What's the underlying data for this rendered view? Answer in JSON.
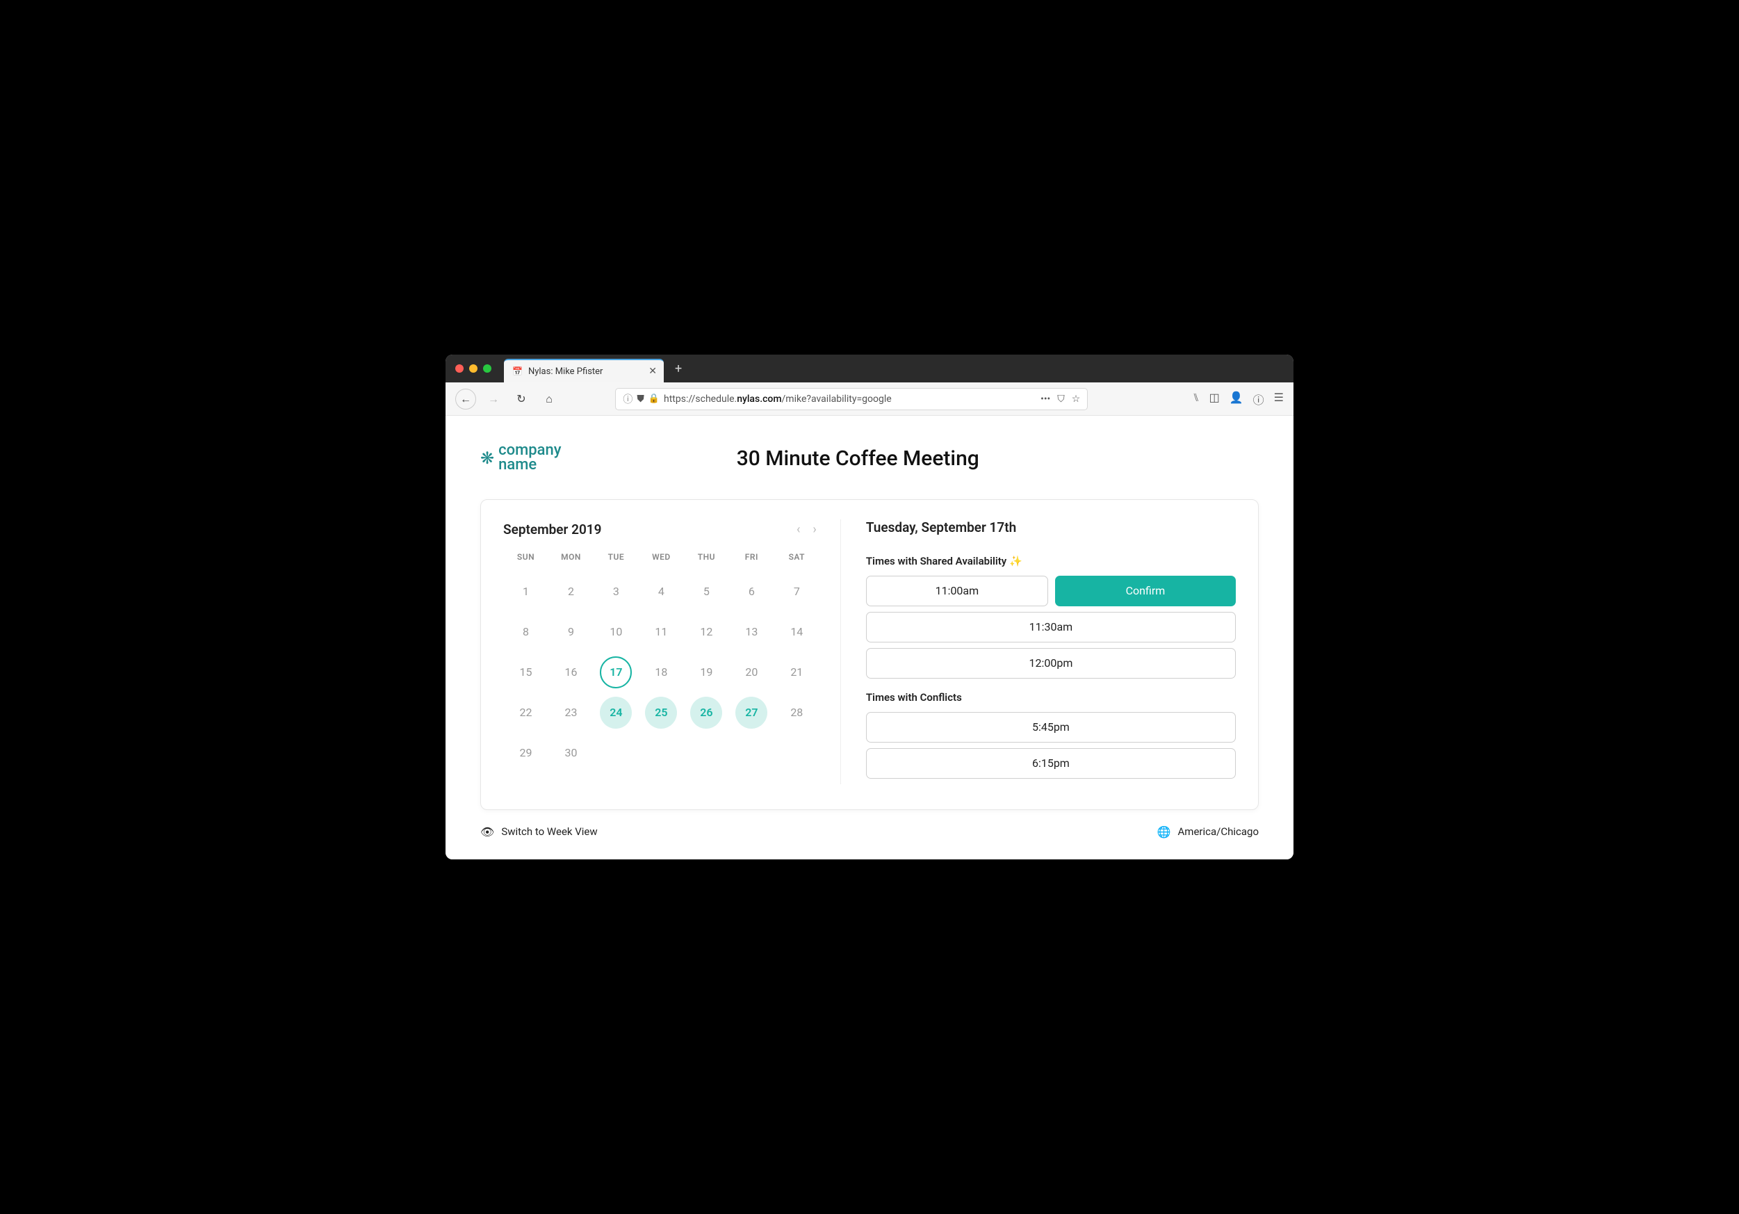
{
  "browser": {
    "tab_title": "Nylas: Mike Pfister",
    "url_prefix": "https://schedule.",
    "url_domain": "nylas.com",
    "url_path": "/mike?availability=google"
  },
  "logo": {
    "line1": "company",
    "line2": "name"
  },
  "page_title": "30 Minute Coffee Meeting",
  "calendar": {
    "month_label": "September 2019",
    "headers": [
      "SUN",
      "MON",
      "TUE",
      "WED",
      "THU",
      "FRI",
      "SAT"
    ],
    "weeks": [
      [
        {
          "d": "1"
        },
        {
          "d": "2"
        },
        {
          "d": "3"
        },
        {
          "d": "4"
        },
        {
          "d": "5"
        },
        {
          "d": "6"
        },
        {
          "d": "7"
        }
      ],
      [
        {
          "d": "8"
        },
        {
          "d": "9"
        },
        {
          "d": "10"
        },
        {
          "d": "11"
        },
        {
          "d": "12"
        },
        {
          "d": "13"
        },
        {
          "d": "14"
        }
      ],
      [
        {
          "d": "15"
        },
        {
          "d": "16"
        },
        {
          "d": "17",
          "selected": true
        },
        {
          "d": "18"
        },
        {
          "d": "19"
        },
        {
          "d": "20"
        },
        {
          "d": "21"
        }
      ],
      [
        {
          "d": "22"
        },
        {
          "d": "23"
        },
        {
          "d": "24",
          "avail": true
        },
        {
          "d": "25",
          "avail": true
        },
        {
          "d": "26",
          "avail": true
        },
        {
          "d": "27",
          "avail": true
        },
        {
          "d": "28"
        }
      ],
      [
        {
          "d": "29"
        },
        {
          "d": "30"
        },
        {
          "d": ""
        },
        {
          "d": ""
        },
        {
          "d": ""
        },
        {
          "d": ""
        },
        {
          "d": ""
        }
      ]
    ]
  },
  "times": {
    "day_label": "Tuesday, September 17th",
    "shared_label": "Times with Shared Availability ✨",
    "shared": [
      {
        "time": "11:00am",
        "selected": true
      },
      {
        "time": "11:30am"
      },
      {
        "time": "12:00pm"
      }
    ],
    "confirm_label": "Confirm",
    "conflicts_label": "Times with Conflicts",
    "conflicts": [
      {
        "time": "5:45pm"
      },
      {
        "time": "6:15pm"
      }
    ]
  },
  "footer": {
    "switch_label": "Switch to Week View",
    "timezone": "America/Chicago"
  }
}
